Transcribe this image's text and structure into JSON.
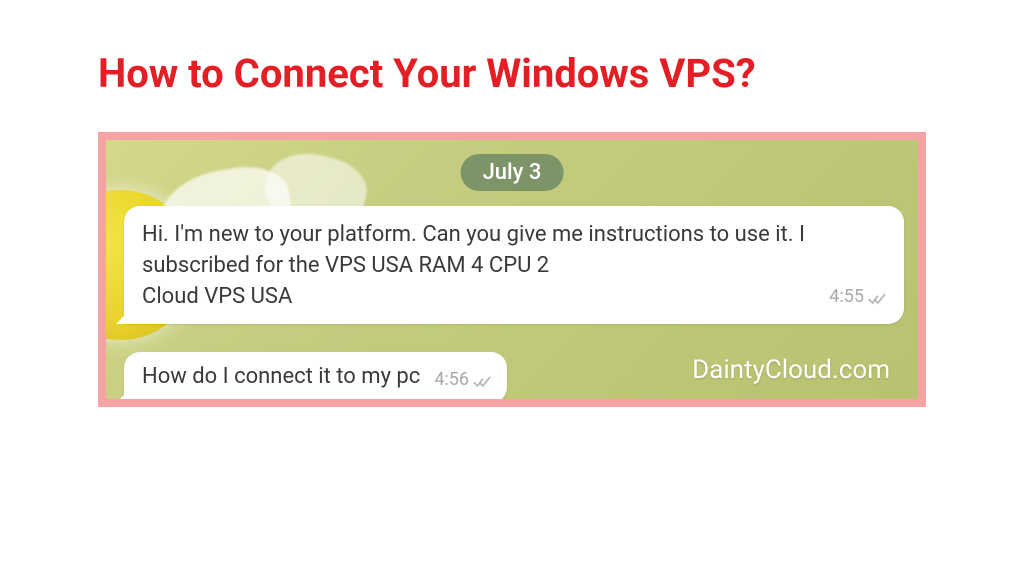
{
  "title": "How to Connect Your Windows VPS?",
  "chat": {
    "date_badge": "July 3",
    "message1": {
      "text": "Hi. I'm new to your platform. Can you give me instructions to use it. I subscribed for the VPS USA RAM 4 CPU 2\nCloud VPS USA",
      "time": "4:55"
    },
    "message2": {
      "text": "How do I connect it to my pc",
      "time": "4:56"
    }
  },
  "watermark": "DaintyCloud.com",
  "colors": {
    "accent_red": "#e31e24",
    "frame_pink": "#f5a3a3",
    "date_badge_bg": "#7d9468"
  }
}
